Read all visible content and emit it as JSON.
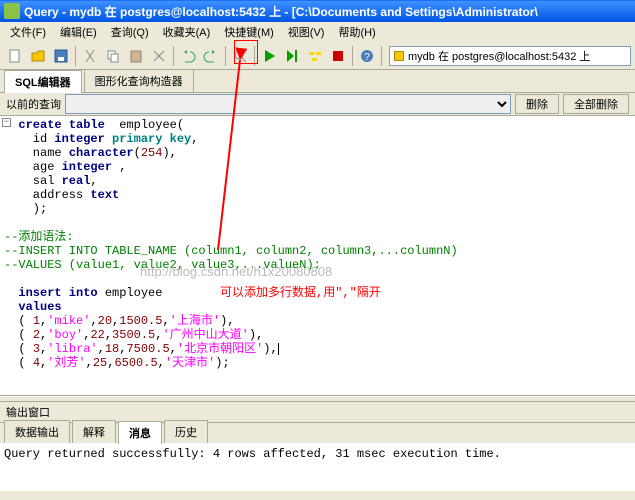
{
  "title": "Query - mydb 在 postgres@localhost:5432 上 - [C:\\Documents and Settings\\Administrator\\",
  "menu": {
    "file": "文件(F)",
    "edit": "编辑(E)",
    "query": "查询(Q)",
    "favorites": "收藏夹(A)",
    "macros": "快捷键(M)",
    "view": "视图(V)",
    "help": "帮助(H)"
  },
  "dbinfo": "mydb 在 postgres@localhost:5432 上",
  "tabs": {
    "sql": "SQL编辑器",
    "gui": "图形化查询构造器"
  },
  "history": {
    "label": "以前的查询",
    "btn_delete": "删除",
    "btn_delete_all": "全部删除"
  },
  "code": {
    "l1_a": "create",
    "l1_b": " table",
    "l1_c": "  employee(",
    "l2_a": "    id ",
    "l2_b": "integer",
    "l2_c": " primary key",
    "l3_a": "    name ",
    "l3_b": "character",
    "l3_c": "(",
    "l3_d": "254",
    "l3_e": "),",
    "l4_a": "    age ",
    "l4_b": "integer",
    "l4_c": " ,",
    "l5_a": "    sal ",
    "l5_b": "real",
    "l5_c": ",",
    "l6_a": "    address ",
    "l6_b": "text",
    "l7": "    );",
    "c1": "--添加语法:",
    "c2": "--INSERT INTO TABLE_NAME (column1, column2, column3,...columnN)",
    "c3": "--VALUES (value1, value2, value3,...valueN);",
    "i1_a": "  insert",
    "i1_b": " into",
    "i1_c": " employee",
    "i2_a": "  values",
    "r1_a": "  ( ",
    "r1_b": "1",
    "r1_c": ",",
    "r1_d": "'mike'",
    "r1_e": ",",
    "r1_f": "20",
    "r1_g": ",",
    "r1_h": "1500.5",
    "r1_i": ",",
    "r1_j": "'上海市'",
    "r1_k": "),",
    "r2_a": "  ( ",
    "r2_b": "2",
    "r2_c": ",",
    "r2_d": "'boy'",
    "r2_e": ",",
    "r2_f": "22",
    "r2_g": ",",
    "r2_h": "3500.5",
    "r2_i": ",",
    "r2_j": "'广州中山大道'",
    "r2_k": "),",
    "r3_a": "  ( ",
    "r3_b": "3",
    "r3_c": ",",
    "r3_d": "'libra'",
    "r3_e": ",",
    "r3_f": "18",
    "r3_g": ",",
    "r3_h": "7500.5",
    "r3_i": ",",
    "r3_j": "'北京市朝阳区'",
    "r3_k": "),",
    "r4_a": "  ( ",
    "r4_b": "4",
    "r4_c": ",",
    "r4_d": "'刘芳'",
    "r4_e": ",",
    "r4_f": "25",
    "r4_g": ",",
    "r4_h": "6500.5",
    "r4_i": ",",
    "r4_j": "'天津市'",
    "r4_k": ");",
    "annot_text": "可以添加多行数据,用\",\"隔开"
  },
  "watermark": "http://blog.csdn.net/h1x20080808",
  "output": {
    "label": "输出窗口",
    "tabs": {
      "data": "数据输出",
      "explain": "解释",
      "messages": "消息",
      "history": "历史"
    },
    "msg": "Query returned successfully: 4 rows affected, 31 msec execution time."
  }
}
